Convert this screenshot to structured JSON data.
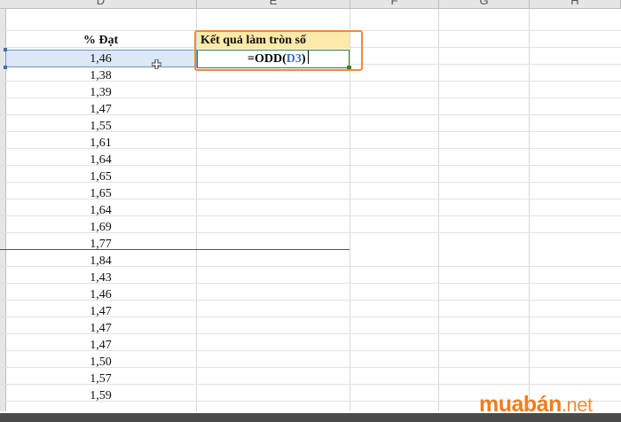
{
  "columns": [
    {
      "id": "D",
      "label": "D"
    },
    {
      "id": "E",
      "label": "E"
    },
    {
      "id": "F",
      "label": "F"
    },
    {
      "id": "G",
      "label": "G"
    },
    {
      "id": "H",
      "label": "H"
    }
  ],
  "sheet": {
    "header_d": "% Đạt",
    "header_e": "Kết quả làm tròn số",
    "values": [
      "1,46",
      "1,38",
      "1,39",
      "1,47",
      "1,55",
      "1,61",
      "1,64",
      "1,65",
      "1,65",
      "1,64",
      "1,69",
      "1,77",
      "1,84",
      "1,43",
      "1,46",
      "1,47",
      "1,47",
      "1,47",
      "1,50",
      "1,57",
      "1,59"
    ]
  },
  "formula": {
    "prefix": "=ODD(",
    "ref": "D3",
    "suffix": ")"
  },
  "watermark": {
    "text": "muabán",
    "suffix": ".net"
  },
  "colors": {
    "header_fill": "#fde9a9",
    "selection": "#dbe8f6",
    "highlight_border": "#f08a3c",
    "cell_ref": "#3d6db5",
    "watermark": "#f07d1d"
  }
}
